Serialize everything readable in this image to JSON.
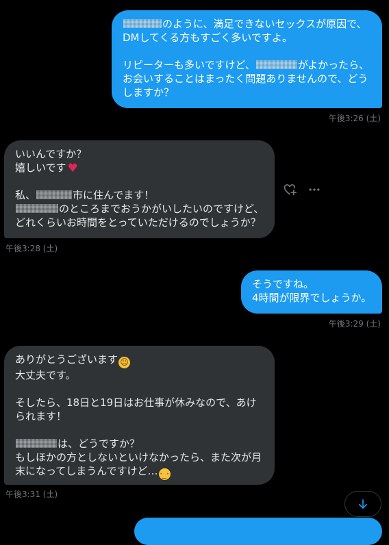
{
  "messages": [
    {
      "direction": "sent",
      "lines": [
        {
          "parts": [
            {
              "blur": 56
            },
            {
              "text": "のように、満足できないセックスが原因で、"
            }
          ]
        },
        {
          "parts": [
            {
              "text": "DMしてくる方もすごく多いですよ。"
            }
          ]
        },
        {
          "parts": []
        },
        {
          "parts": [
            {
              "text": "リピーターも多いですけど、"
            },
            {
              "blur": 60
            },
            {
              "text": "がよかったら、"
            }
          ]
        },
        {
          "parts": [
            {
              "text": "お会いすることはまったく問題ありませんので、どう"
            }
          ]
        },
        {
          "parts": [
            {
              "text": "しますか？"
            }
          ]
        }
      ],
      "timestamp": "午後3:26 (土)"
    },
    {
      "direction": "received",
      "lines": [
        {
          "parts": [
            {
              "text": "いいんですか？"
            }
          ]
        },
        {
          "parts": [
            {
              "text": "嬉しいです"
            },
            {
              "emoji": "heart",
              "char": "♥"
            }
          ]
        },
        {
          "parts": []
        },
        {
          "parts": [
            {
              "text": "私、"
            },
            {
              "blur": 52
            },
            {
              "text": "市に住んでます！"
            }
          ]
        },
        {
          "parts": [
            {
              "blur": 62
            },
            {
              "text": "のところまでおうかがいしたいのですけど、"
            }
          ]
        },
        {
          "parts": [
            {
              "text": "どれくらいお時間をとっていただけるのでしょうか？"
            }
          ]
        }
      ],
      "timestamp": "午後3:28 (土)"
    },
    {
      "direction": "sent",
      "lines": [
        {
          "parts": [
            {
              "text": "そうですね。"
            }
          ]
        },
        {
          "parts": [
            {
              "text": "4時間が限界でしょうか。"
            }
          ]
        }
      ],
      "timestamp": "午後3:29 (土)"
    },
    {
      "direction": "received",
      "lines": [
        {
          "parts": [
            {
              "text": "ありがとうございます"
            },
            {
              "emoji": "blush",
              "char": "☺"
            }
          ]
        },
        {
          "parts": [
            {
              "text": "大丈夫です。"
            }
          ]
        },
        {
          "parts": []
        },
        {
          "parts": [
            {
              "text": "そしたら、18日と19日はお仕事が休みなので、あけ"
            }
          ]
        },
        {
          "parts": [
            {
              "text": "られます！"
            }
          ]
        },
        {
          "parts": []
        },
        {
          "parts": [
            {
              "blur": 60
            },
            {
              "text": "は、どうですか？"
            }
          ]
        },
        {
          "parts": [
            {
              "text": "もしほかの方としないといけなかったら、また次が月"
            }
          ]
        },
        {
          "parts": [
            {
              "text": "末になってしまうんですけど…"
            },
            {
              "emoji": "cry",
              "char": "·_·"
            }
          ]
        }
      ],
      "timestamp": "午後3:31 (土)"
    }
  ],
  "icons": {
    "react": "heart-plus-icon",
    "more": "more-icon",
    "scroll": "arrow-down-icon"
  },
  "colors": {
    "background": "#000000",
    "sent_bubble": "#1d9bf0",
    "received_bubble": "#2f3336",
    "timestamp": "#71767b",
    "accent": "#1d9bf0"
  }
}
